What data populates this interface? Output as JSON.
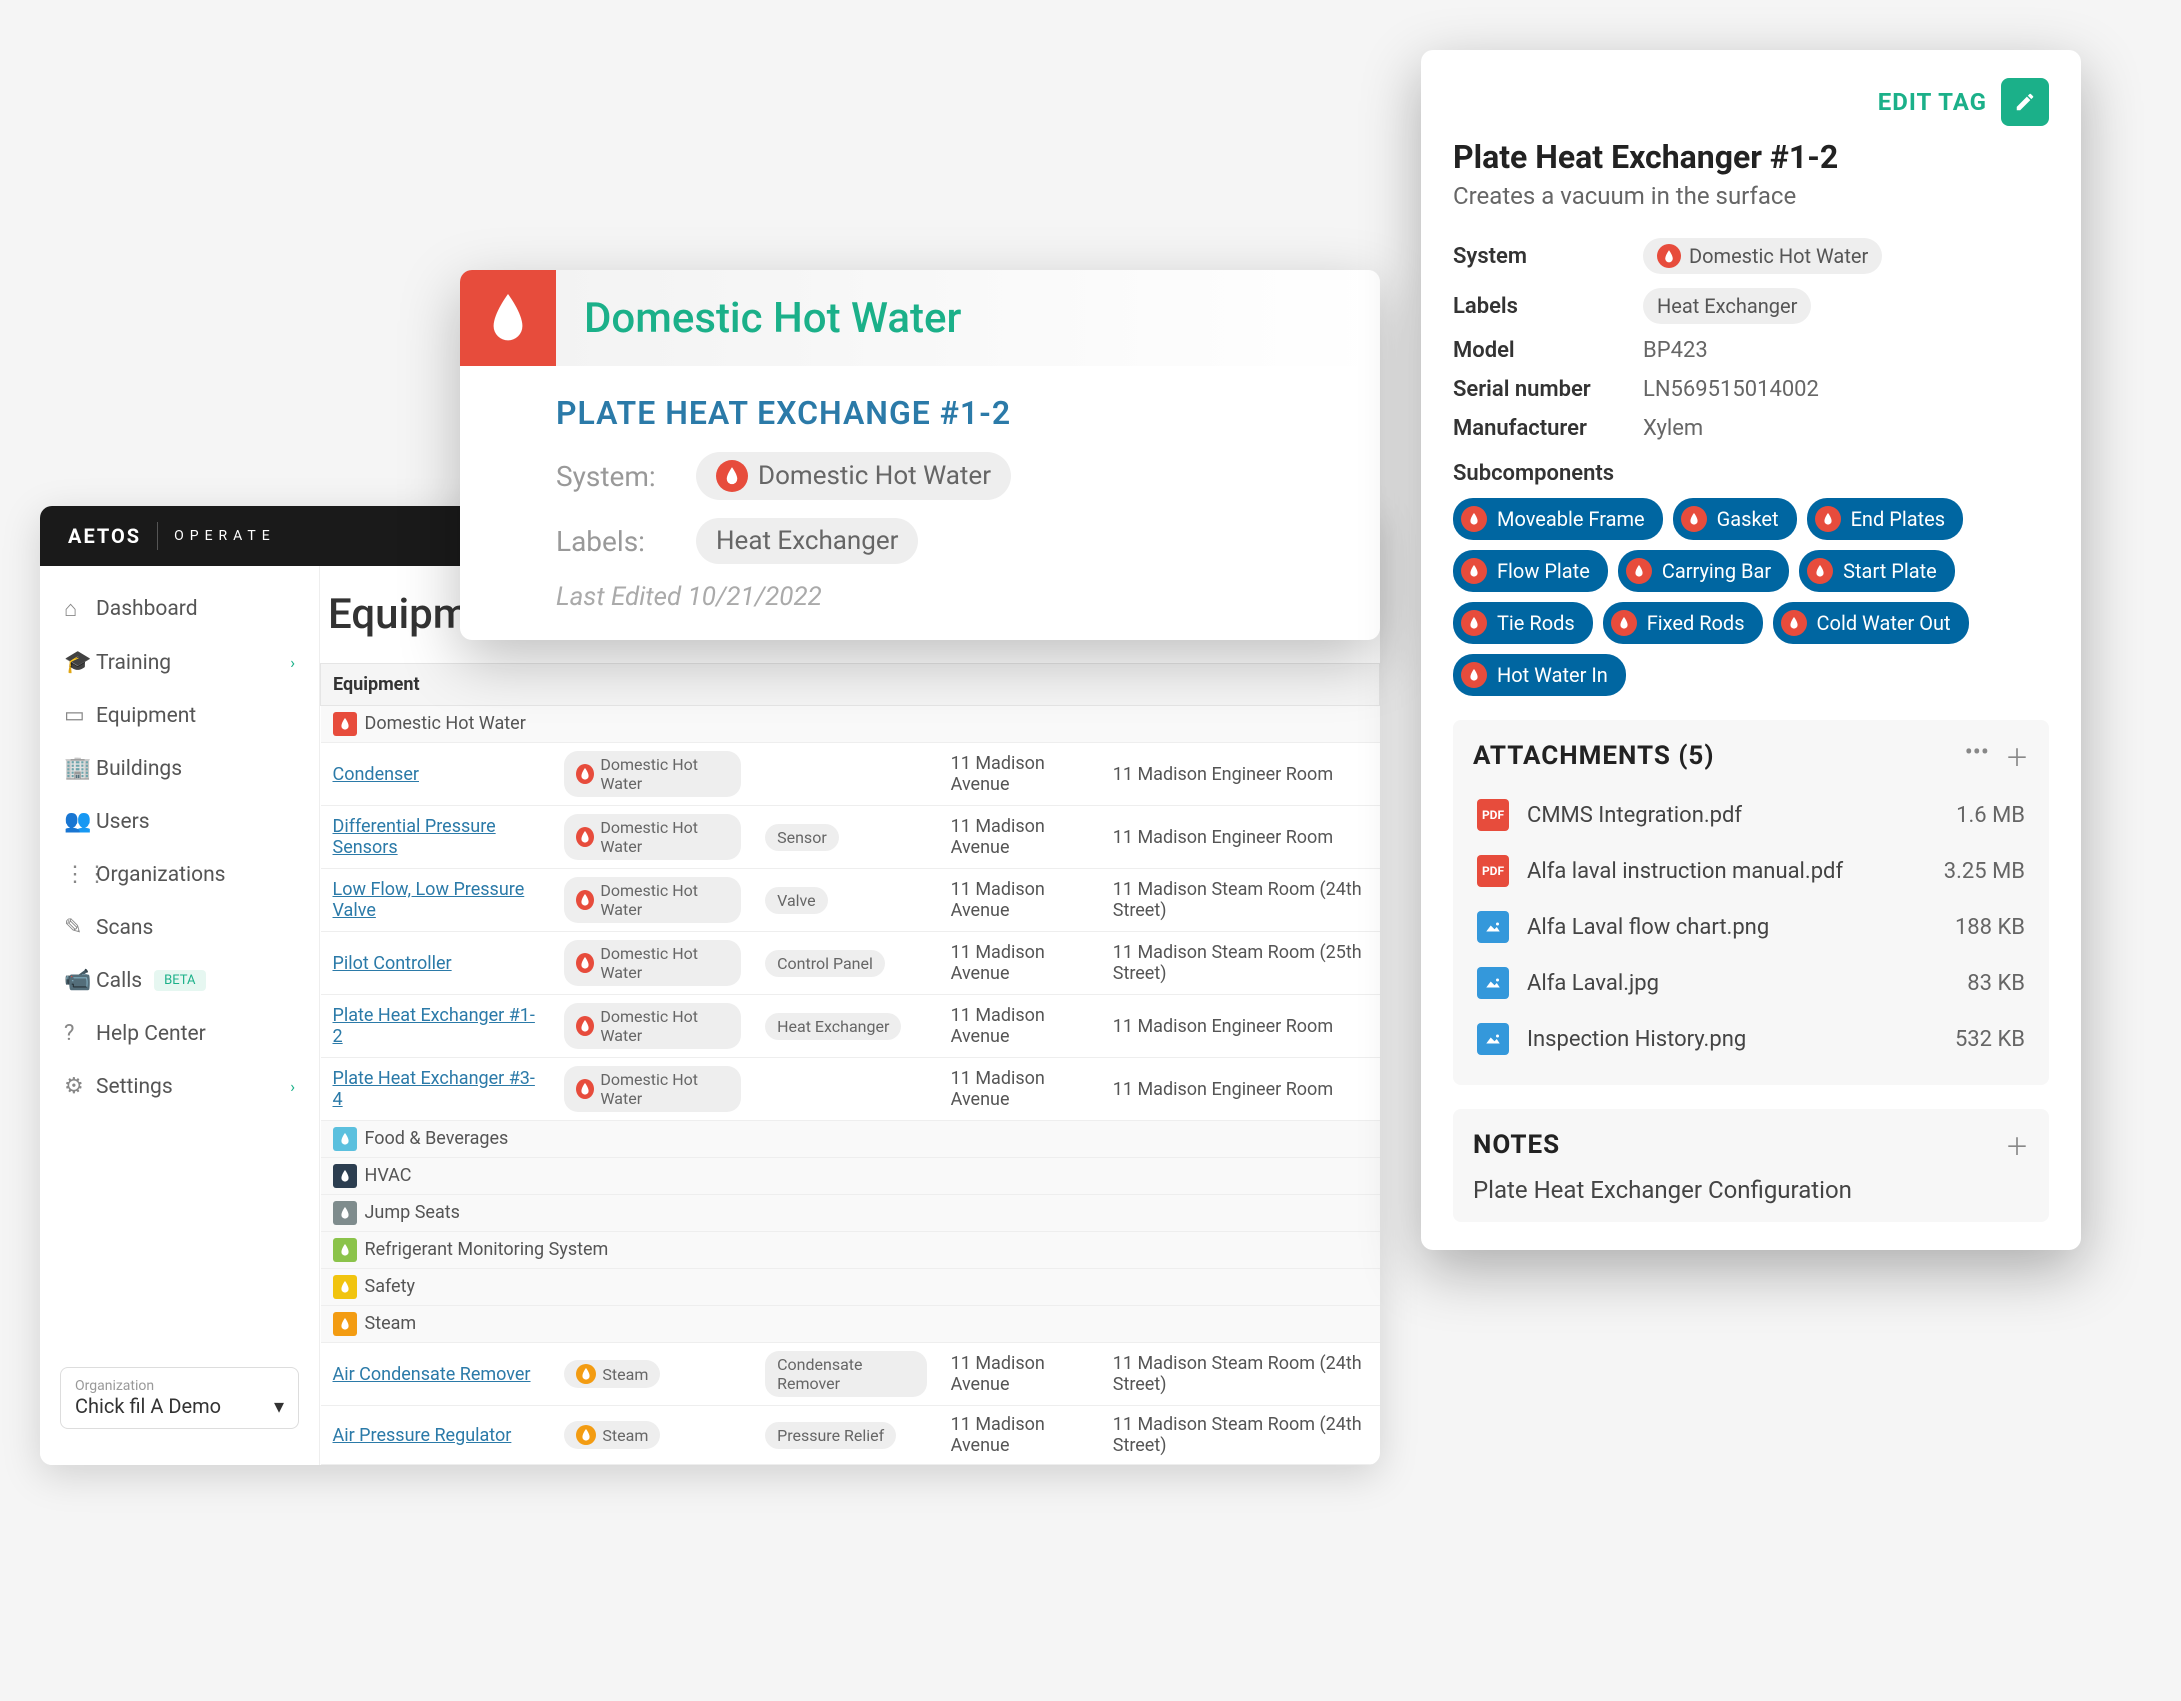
{
  "brand": "AETOS",
  "brand_sub": "OPERATE",
  "sidebar": {
    "items": [
      {
        "label": "Dashboard"
      },
      {
        "label": "Training",
        "expandable": true
      },
      {
        "label": "Equipment"
      },
      {
        "label": "Buildings"
      },
      {
        "label": "Users"
      },
      {
        "label": "Organizations"
      },
      {
        "label": "Scans"
      },
      {
        "label": "Calls",
        "badge": "BETA"
      },
      {
        "label": "Help Center"
      },
      {
        "label": "Settings",
        "expandable": true
      }
    ],
    "org_label": "Organization",
    "org_value": "Chick fil A Demo"
  },
  "content": {
    "title": "Equipment",
    "header": "Equipment",
    "rows": [
      {
        "type": "group",
        "label": "Domestic Hot Water",
        "color": "#e74c3c"
      },
      {
        "type": "item",
        "name": "Condenser",
        "system": "Domestic Hot Water",
        "label": "",
        "addr": "11 Madison Avenue",
        "room": "11 Madison Engineer Room"
      },
      {
        "type": "item",
        "name": "Differential Pressure Sensors",
        "system": "Domestic Hot Water",
        "label": "Sensor",
        "addr": "11 Madison Avenue",
        "room": "11 Madison Engineer Room"
      },
      {
        "type": "item",
        "name": "Low Flow, Low Pressure Valve",
        "system": "Domestic Hot Water",
        "label": "Valve",
        "addr": "11 Madison Avenue",
        "room": "11 Madison Steam Room (24th Street)"
      },
      {
        "type": "item",
        "name": "Pilot Controller",
        "system": "Domestic Hot Water",
        "label": "Control Panel",
        "addr": "11 Madison Avenue",
        "room": "11 Madison Steam Room (25th Street)"
      },
      {
        "type": "item",
        "name": "Plate Heat Exchanger #1-2",
        "system": "Domestic Hot Water",
        "label": "Heat Exchanger",
        "addr": "11 Madison Avenue",
        "room": "11 Madison Engineer Room"
      },
      {
        "type": "item",
        "name": "Plate Heat Exchanger #3-4",
        "system": "Domestic Hot Water",
        "label": "",
        "addr": "11 Madison Avenue",
        "room": "11 Madison Engineer Room"
      },
      {
        "type": "group",
        "label": "Food & Beverages",
        "color": "#5bc0de"
      },
      {
        "type": "group",
        "label": "HVAC",
        "color": "#2c3e50"
      },
      {
        "type": "group",
        "label": "Jump Seats",
        "color": "#7f8c8d"
      },
      {
        "type": "group",
        "label": "Refrigerant Monitoring System",
        "color": "#8bc34a"
      },
      {
        "type": "group",
        "label": "Safety",
        "color": "#f1c40f"
      },
      {
        "type": "group",
        "label": "Steam",
        "color": "#f39c12"
      },
      {
        "type": "item",
        "name": "Air Condensate Remover",
        "system": "Steam",
        "system_color": "orange",
        "label": "Condensate Remover",
        "addr": "11 Madison Avenue",
        "room": "11 Madison Steam Room (24th Street)"
      },
      {
        "type": "item",
        "name": "Air Pressure Regulator",
        "system": "Steam",
        "system_color": "orange",
        "label": "Pressure Relief",
        "addr": "11 Madison Avenue",
        "room": "11 Madison Steam Room (24th Street)"
      }
    ]
  },
  "card1": {
    "system": "Domestic Hot Water",
    "title": "PLATE HEAT EXCHANGE #1-2",
    "system_label": "System:",
    "system_value": "Domestic Hot Water",
    "labels_label": "Labels:",
    "labels_value": "Heat Exchanger",
    "edited": "Last Edited 10/21/2022"
  },
  "detail": {
    "edit_label": "EDIT TAG",
    "title": "Plate Heat Exchanger #1-2",
    "desc": "Creates a vacuum in the surface",
    "system_label": "System",
    "system_value": "Domestic Hot Water",
    "labels_label": "Labels",
    "labels_value": "Heat Exchanger",
    "model_label": "Model",
    "model_value": "BP423",
    "serial_label": "Serial number",
    "serial_value": "LN569515014002",
    "mfr_label": "Manufacturer",
    "mfr_value": "Xylem",
    "subcomp_label": "Subcomponents",
    "subcomponents": [
      "Moveable Frame",
      "Gasket",
      "End Plates",
      "Flow Plate",
      "Carrying Bar",
      "Start Plate",
      "Tie Rods",
      "Fixed Rods",
      "Cold Water Out",
      "Hot Water In"
    ],
    "attachments_title": "ATTACHMENTS (5)",
    "attachments": [
      {
        "name": "CMMS Integration.pdf",
        "size": "1.6 MB",
        "type": "pdf"
      },
      {
        "name": "Alfa laval instruction manual.pdf",
        "size": "3.25 MB",
        "type": "pdf"
      },
      {
        "name": "Alfa Laval flow chart.png",
        "size": "188 KB",
        "type": "img"
      },
      {
        "name": "Alfa Laval.jpg",
        "size": "83 KB",
        "type": "img"
      },
      {
        "name": "Inspection History.png",
        "size": "532 KB",
        "type": "img"
      }
    ],
    "notes_title": "NOTES",
    "note_text": "Plate Heat Exchanger Configuration"
  }
}
